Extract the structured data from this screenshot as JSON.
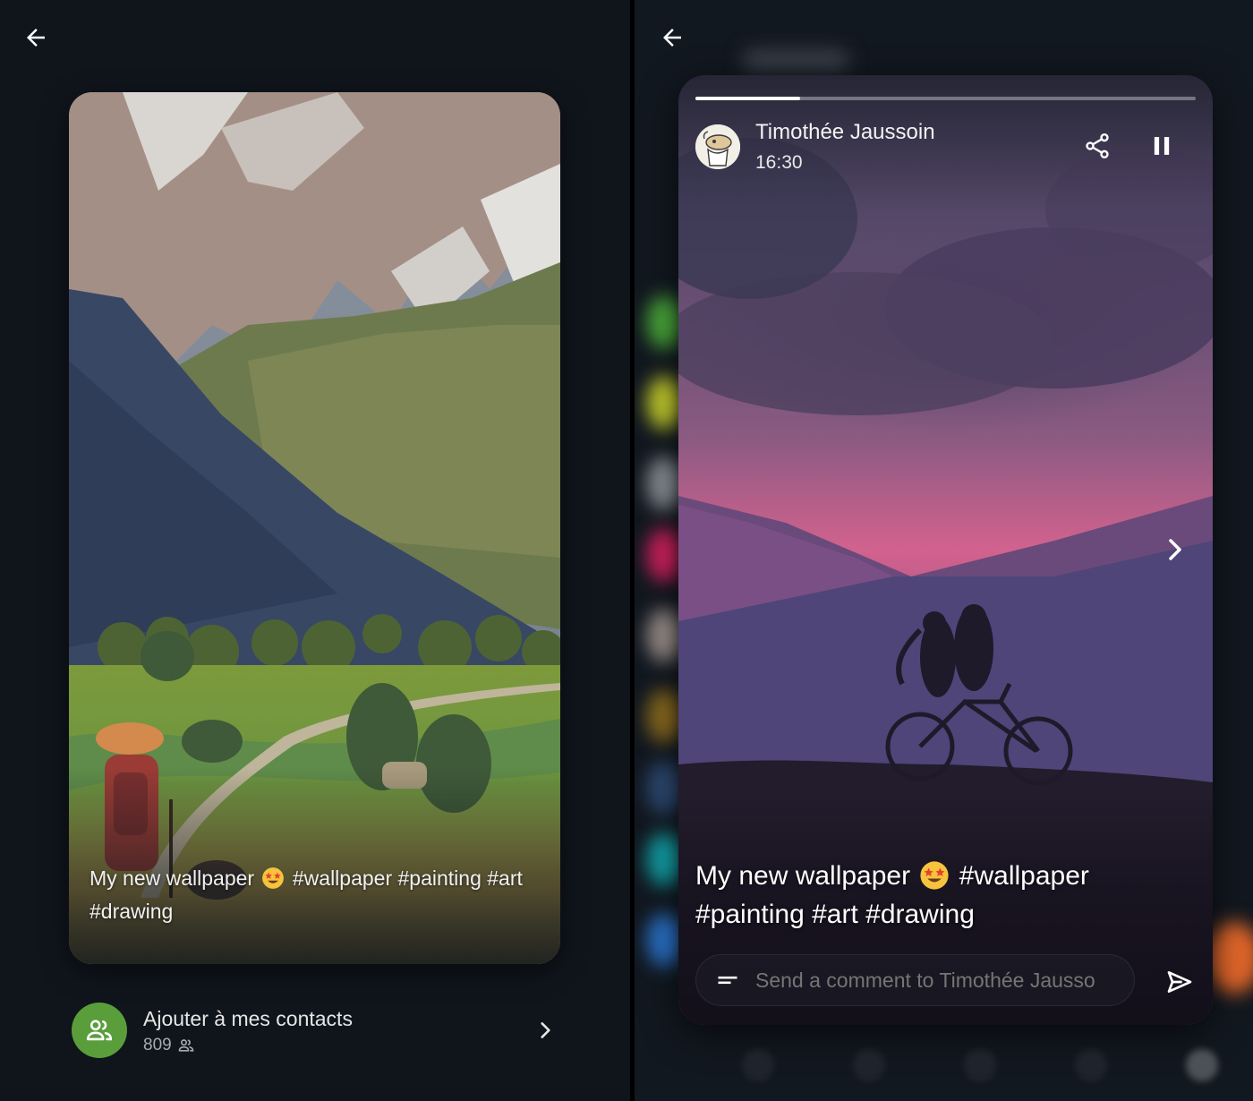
{
  "left": {
    "caption_text_1": "My new wallpaper",
    "caption_text_2": "#wallpaper #painting #art #drawing",
    "contact": {
      "title": "Ajouter à mes contacts",
      "count": "809"
    }
  },
  "right": {
    "author": {
      "name": "Timothée Jaussoin",
      "time": "16:30"
    },
    "progress_fraction": 0.21,
    "caption_text_1": "My new wallpaper",
    "caption_text_2": "#wallpaper #painting #art #drawing",
    "comment": {
      "placeholder": "Send a comment to Timothée Jausso"
    }
  },
  "icons": {
    "back": "arrow-left-icon",
    "contacts": "people-icon",
    "chevron": "chevron-right-icon",
    "share": "share-icon",
    "pause": "pause-icon",
    "comment": "subject-icon",
    "send": "send-icon",
    "emoji": "star-struck-emoji"
  },
  "colors": {
    "background": "#10151c",
    "contact_avatar": "#5a9e3c",
    "text": "#e8eaed"
  }
}
